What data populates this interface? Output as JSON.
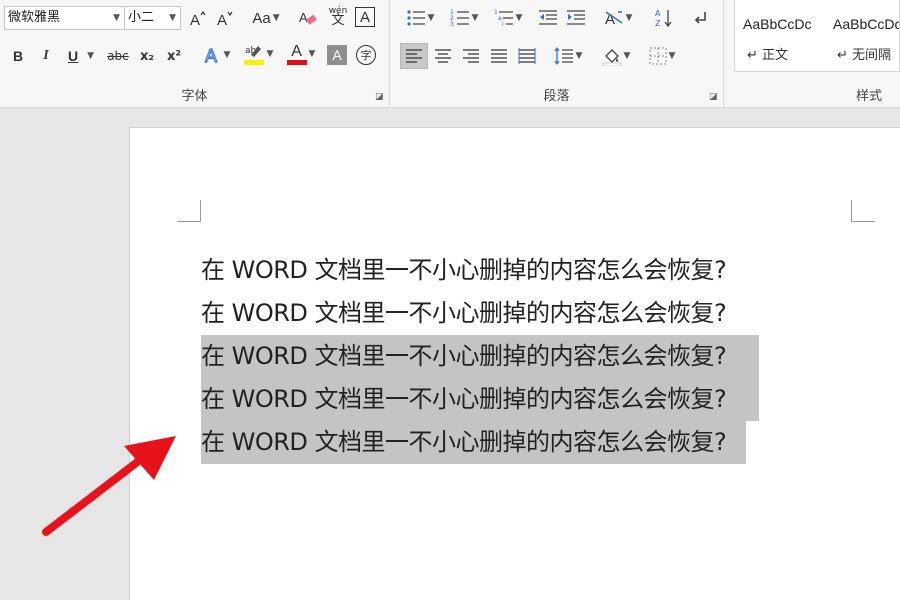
{
  "font_group": {
    "font_name": "微软雅黑",
    "font_size": "小二",
    "label": "字体",
    "change_case_label": "Aa",
    "phonetic_top": "wén",
    "phonetic_bottom": "文",
    "border_char": "A",
    "bold": "B",
    "italic": "I",
    "underline": "U",
    "strikethrough": "abc",
    "subscript": "x₂",
    "superscript": "x²",
    "font_color_char": "A",
    "shading_char": "A",
    "enclose_char": "字",
    "highlight_color": "#f5f100",
    "font_color": "#e01010"
  },
  "paragraph_group": {
    "label": "段落"
  },
  "styles_group": {
    "label": "样式",
    "items": [
      {
        "sample": "AaBbCcDc",
        "name": "↵ 正文"
      },
      {
        "sample": "AaBbCcDc",
        "name": "↵ 无间隔"
      }
    ]
  },
  "document": {
    "lines": [
      "在 WORD 文档里一不小心删掉的内容怎么会恢复?",
      "在 WORD 文档里一不小心删掉的内容怎么会恢复?",
      "在 WORD 文档里一不小心删掉的内容怎么会恢复?",
      "在 WORD 文档里一不小心删掉的内容怎么会恢复?",
      "在 WORD 文档里一不小心删掉的内容怎么会恢复?"
    ],
    "selected_line_indices": [
      2,
      3,
      4
    ]
  },
  "annotation": {
    "arrow_color": "#e8121c"
  }
}
